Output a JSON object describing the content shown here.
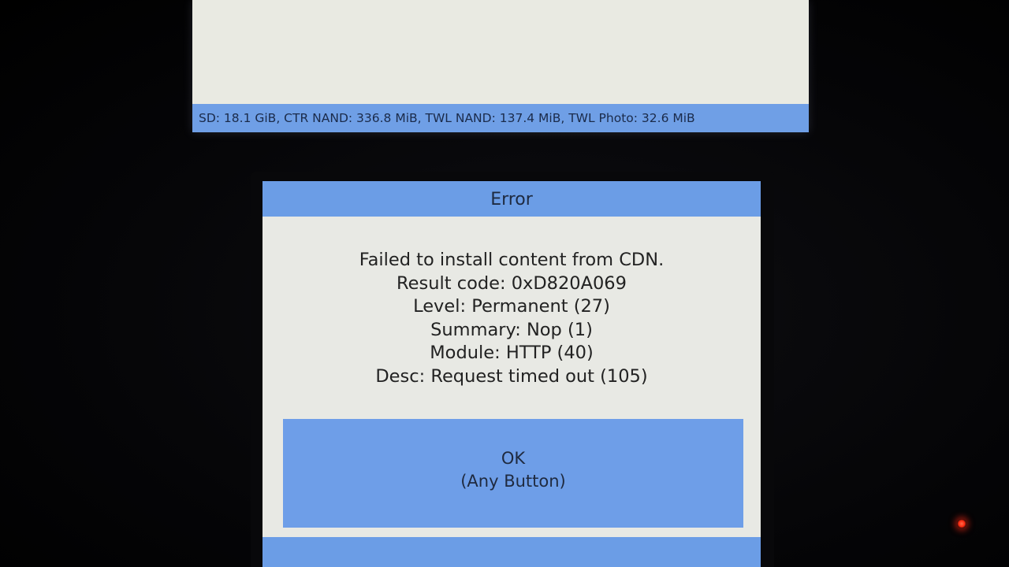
{
  "top_screen": {
    "status": "SD: 18.1 GiB, CTR NAND: 336.8 MiB, TWL NAND: 137.4 MiB, TWL Photo: 32.6 MiB"
  },
  "dialog": {
    "title": "Error",
    "lines": [
      "Failed to install content from CDN.",
      "Result code: 0xD820A069",
      "Level: Permanent (27)",
      "Summary: Nop (1)",
      "Module: HTTP (40)",
      "Desc: Request timed out (105)"
    ],
    "ok_label": "OK",
    "ok_hint": "(Any Button)"
  },
  "colors": {
    "accent": "#6b9de6",
    "screen_background": "#e8e9e4",
    "led": "#ff2a10"
  }
}
